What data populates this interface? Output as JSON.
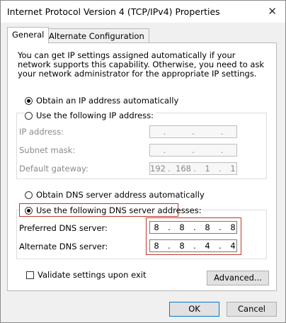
{
  "window": {
    "title": "Internet Protocol Version 4 (TCP/IPv4) Properties",
    "close_glyph": "✕"
  },
  "tabs": [
    {
      "label": "General",
      "active": true
    },
    {
      "label": "Alternate Configuration",
      "active": false
    }
  ],
  "description": "You can get IP settings assigned automatically if your network supports this capability. Otherwise, you need to ask your network administrator for the appropriate IP settings.",
  "ip_section": {
    "auto_label": "Obtain an IP address automatically",
    "manual_label": "Use the following IP address:",
    "ip_address_label": "IP address:",
    "subnet_label": "Subnet mask:",
    "gateway_label": "Default gateway:",
    "ip_address": [
      ".",
      ".",
      "."
    ],
    "subnet_mask": [
      ".",
      ".",
      "."
    ],
    "gateway": [
      "192",
      ".",
      "168",
      ".",
      "1",
      ".",
      "1"
    ]
  },
  "dns_section": {
    "auto_label": "Obtain DNS server address automatically",
    "manual_label": "Use the following DNS server addresses:",
    "preferred_label": "Preferred DNS server:",
    "alternate_label": "Alternate DNS server:",
    "preferred": [
      "8",
      ".",
      "8",
      ".",
      "8",
      ".",
      "8"
    ],
    "alternate": [
      "8",
      ".",
      "8",
      ".",
      "4",
      ".",
      "4"
    ]
  },
  "validate_label": "Validate settings upon exit",
  "buttons": {
    "advanced": "Advanced...",
    "ok": "OK",
    "cancel": "Cancel"
  },
  "colors": {
    "highlight": "#c0392b",
    "primary_border": "#0078d7"
  }
}
